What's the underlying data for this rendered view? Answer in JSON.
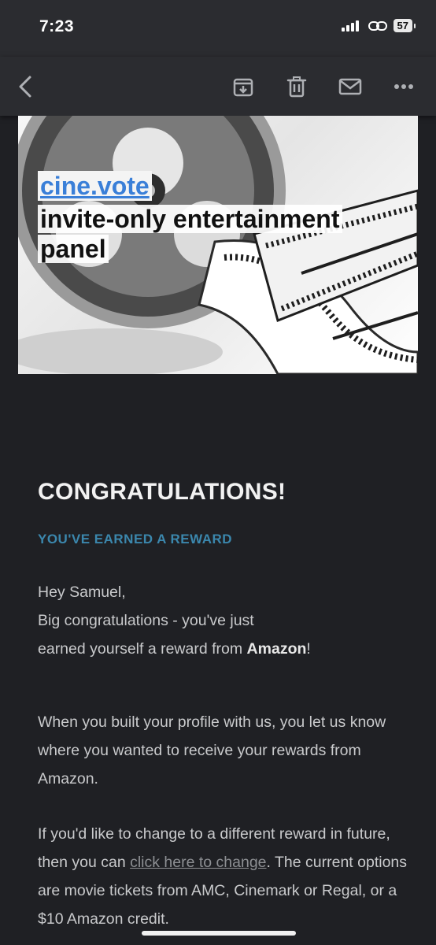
{
  "status_bar": {
    "time": "7:23",
    "battery": "57"
  },
  "toolbar": {
    "icons": [
      "back-icon",
      "archive-icon",
      "trash-icon",
      "mail-icon",
      "more-icon"
    ]
  },
  "hero": {
    "link_text": "cine.vote",
    "title": "invite-only entertainment panel"
  },
  "email": {
    "heading": "CONGRATULATIONS!",
    "subheading": "YOU'VE EARNED A REWARD",
    "greeting": "Hey Samuel,",
    "intro_line1": "Big congratulations - you've just",
    "intro_line2_before": "earned yourself a reward from ",
    "intro_brand": "Amazon",
    "intro_line2_after": "!",
    "profile_paragraph": "When you built your profile with us, you let us know where you wanted to receive your rewards from Amazon.",
    "change_before": "If you'd like to change to a different reward in future, then you can ",
    "change_link": "click here to change",
    "change_after": ". The current options are movie tickets from AMC, Cinemark or Regal, or a $10 Amazon credit."
  },
  "colors": {
    "background": "#1f2024",
    "accent": "#3b87ad",
    "link": "#3a7fd8"
  }
}
